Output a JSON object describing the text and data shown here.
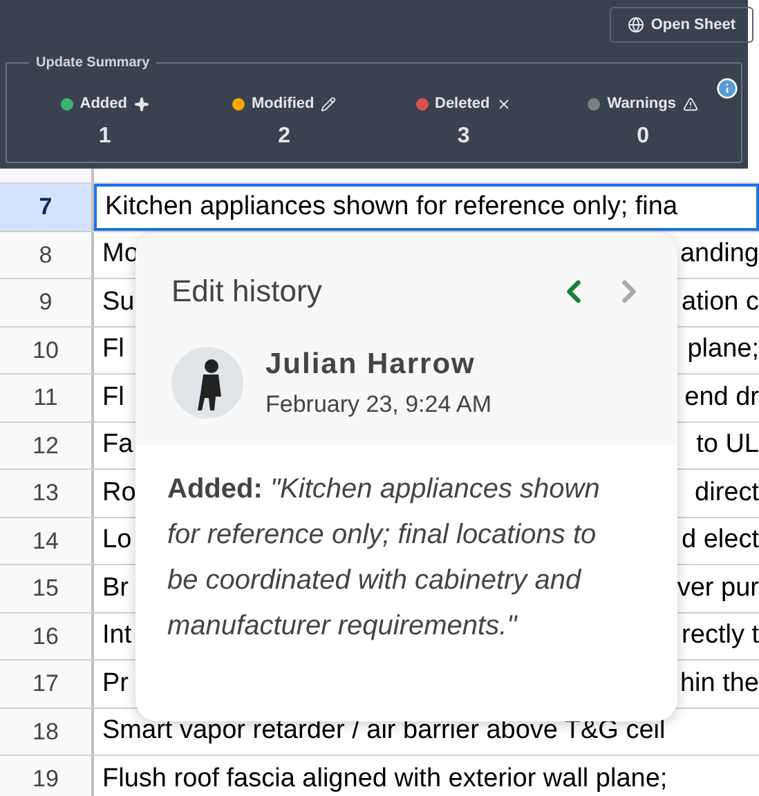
{
  "toolbar": {
    "open_button": "Open Sheet"
  },
  "summary": {
    "title": "Update Summary",
    "stats": [
      {
        "label": "Added",
        "kind": "sparkle",
        "count": "1",
        "color": "#3cb371"
      },
      {
        "label": "Modified",
        "kind": "pencil",
        "count": "2",
        "color": "#ffa500"
      },
      {
        "label": "Deleted",
        "kind": "cross",
        "count": "3",
        "color": "#d9534f"
      },
      {
        "label": "Warnings",
        "kind": "warning",
        "count": "0",
        "color": "#808080"
      }
    ]
  },
  "rows": [
    {
      "number": "7",
      "selected": true,
      "fragments": [
        "Kitchen appliances shown for reference only; fina"
      ]
    },
    {
      "number": "8",
      "selected": false,
      "fragments": [
        "Mo",
        "anding"
      ]
    },
    {
      "number": "9",
      "selected": false,
      "fragments": [
        "Su",
        "ation c"
      ]
    },
    {
      "number": "10",
      "selected": false,
      "fragments": [
        "Fl",
        "plane;"
      ]
    },
    {
      "number": "11",
      "selected": false,
      "fragments": [
        "Fl",
        "end dr"
      ]
    },
    {
      "number": "12",
      "selected": false,
      "fragments": [
        "Fa",
        "to UL"
      ]
    },
    {
      "number": "13",
      "selected": false,
      "fragments": [
        "Ro",
        "direct"
      ]
    },
    {
      "number": "14",
      "selected": false,
      "fragments": [
        "Lo",
        "d elect"
      ]
    },
    {
      "number": "15",
      "selected": false,
      "fragments": [
        "Br",
        "ver pur"
      ]
    },
    {
      "number": "16",
      "selected": false,
      "fragments": [
        "Int",
        "rectly t"
      ]
    },
    {
      "number": "17",
      "selected": false,
      "fragments": [
        "Pr",
        "hin the"
      ]
    },
    {
      "number": "18",
      "selected": false,
      "fragments": [
        "Smart vapor retarder / air barrier above T&G ceil"
      ]
    },
    {
      "number": "19",
      "selected": false,
      "fragments": [
        "Flush roof fascia aligned with exterior wall plane;"
      ]
    }
  ],
  "popup": {
    "title": "Edit history",
    "prev_disabled": false,
    "next_disabled": true,
    "author": "Julian Harrow",
    "timestamp": "February 23, 9:24 AM",
    "change": "**Added:** *\"Kitchen appliances shown for reference only; final locations to be coordinated with cabinetry and manufacturer requirements.\"*"
  }
}
